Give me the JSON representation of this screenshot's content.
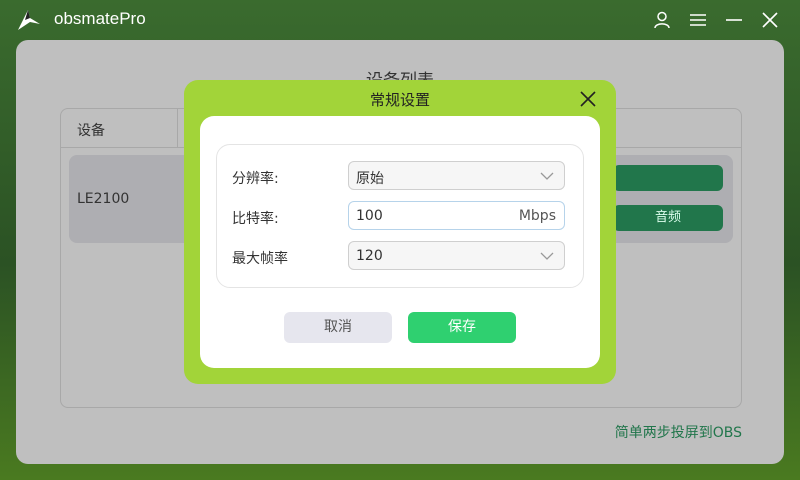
{
  "app": {
    "title": "obsmatePro"
  },
  "main": {
    "title": "设备列表",
    "table_header": {
      "device": "设备"
    },
    "rows": [
      {
        "name": "LE2100",
        "button_audio": "音频"
      }
    ],
    "footer_link": "简单两步投屏到OBS"
  },
  "dialog": {
    "title": "常规设置",
    "resolution": {
      "label": "分辨率:",
      "value": "原始"
    },
    "bitrate": {
      "label": "比特率:",
      "value": "100",
      "unit": "Mbps"
    },
    "max_fps": {
      "label": "最大帧率",
      "value": "120"
    },
    "cancel_label": "取消",
    "save_label": "保存"
  },
  "colors": {
    "dialog_border": "#a2d439",
    "save_button": "#2fd070",
    "accent_green": "#21764b"
  },
  "icons": [
    "logo-icon",
    "user-icon",
    "menu-icon",
    "minimize-icon",
    "close-icon",
    "chevron-down-icon"
  ]
}
